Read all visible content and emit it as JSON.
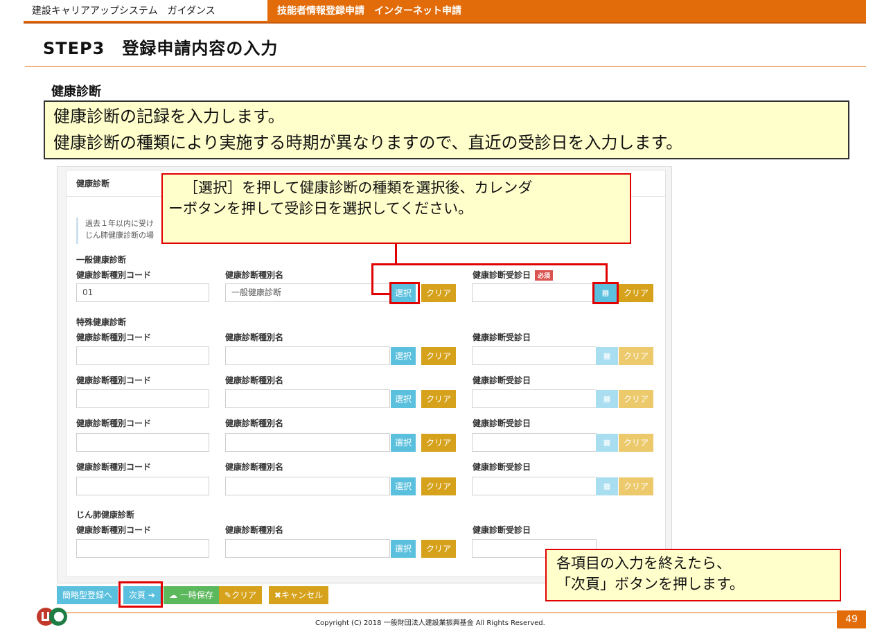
{
  "header": {
    "left_title": "建設キャリアアップシステム　ガイダンス",
    "right_title": "技能者情報登録申請　インターネット申請"
  },
  "step_title": "STEP3　登録申請内容の入力",
  "section_title": "健康診断",
  "note": {
    "line1": "健康診断の記録を入力します。",
    "line2": "健康診断の種類により実施する時期が異なりますので、直近の受診日を入力します。"
  },
  "panel": {
    "title": "健康診断",
    "info_line1": "過去１年以内に受け",
    "info_line2": "じん肺健康診断の場"
  },
  "labels": {
    "code": "健康診断種別コード",
    "name": "健康診断種別名",
    "date": "健康診断受診日",
    "required": "必須",
    "select": "選択",
    "clear": "クリア"
  },
  "groups": {
    "general": "一般健康診断",
    "special": "特殊健康診断",
    "pneumo": "じん肺健康診断"
  },
  "general_row": {
    "code_value": "01",
    "name_value": "一般健康診断"
  },
  "callout1": {
    "line1": "［選択］を押して健康診断の種類を選択後、カレンダ",
    "line2": "ーボタンを押して受診日を選択してください。"
  },
  "callout2": {
    "line1": "各項目の入力を終えたら、",
    "line2": "「次頁」ボタンを押します。"
  },
  "bottom_buttons": {
    "simple": "簡略型登録へ",
    "next": "次頁",
    "save": "一時保存",
    "clear": "クリア",
    "cancel": "キャンセル"
  },
  "footer": {
    "copyright": "Copyright (C) 2018 一般財団法人建設業振興基金 All Rights Reserved.",
    "page_number": "49"
  },
  "colors": {
    "brand_orange": "#e36c0a",
    "select_blue": "#5bc0de",
    "clear_gold": "#d6a21c",
    "callout_red": "#e00000"
  }
}
